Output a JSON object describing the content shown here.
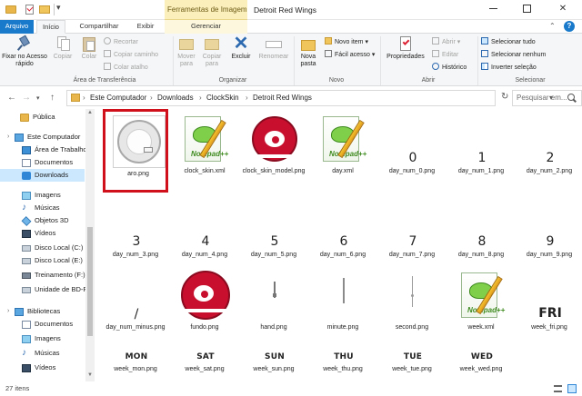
{
  "titlebar": {
    "contextual_tab_header": "Ferramentas de Imagem",
    "window_title": "Detroit Red Wings"
  },
  "tabs": {
    "file": "Arquivo",
    "home": "Início",
    "share": "Compartilhar",
    "view": "Exibir",
    "manage": "Gerenciar"
  },
  "ribbon": {
    "clipboard": {
      "pin": "Fixar no Acesso rápido",
      "copy": "Copiar",
      "paste": "Colar",
      "cut": "Recortar",
      "copy_path": "Copiar caminho",
      "paste_shortcut": "Colar atalho",
      "label": "Área de Transferência"
    },
    "organize": {
      "move_to": "Mover para",
      "copy_to": "Copiar para",
      "delete": "Excluir",
      "rename": "Renomear",
      "label": "Organizar"
    },
    "new": {
      "new_folder": "Nova pasta",
      "new_item": "Novo item",
      "easy_access": "Fácil acesso",
      "label": "Novo"
    },
    "open": {
      "properties": "Propriedades",
      "open": "Abrir",
      "edit": "Editar",
      "history": "Histórico",
      "label": "Abrir"
    },
    "select": {
      "select_all": "Selecionar tudo",
      "select_none": "Selecionar nenhum",
      "invert": "Inverter seleção",
      "label": "Selecionar"
    }
  },
  "address": {
    "crumbs": [
      "Este Computador",
      "Downloads",
      "ClockSkin",
      "Detroit Red Wings"
    ],
    "search_placeholder": "Pesquisar em..."
  },
  "navpane": {
    "items": [
      {
        "label": "Pública",
        "icon": "folder-icon",
        "selected": false
      },
      {
        "label": "Este Computador",
        "icon": "computer-icon",
        "selected": false
      },
      {
        "label": "Área de Trabalho",
        "icon": "desktop-icon",
        "selected": false
      },
      {
        "label": "Documentos",
        "icon": "documents-icon",
        "selected": false
      },
      {
        "label": "Downloads",
        "icon": "downloads-icon",
        "selected": true
      },
      {
        "label": "Imagens",
        "icon": "pictures-icon",
        "selected": false
      },
      {
        "label": "Músicas",
        "icon": "music-icon",
        "selected": false
      },
      {
        "label": "Objetos 3D",
        "icon": "objects3d-icon",
        "selected": false
      },
      {
        "label": "Vídeos",
        "icon": "videos-icon",
        "selected": false
      },
      {
        "label": "Disco Local (C:)",
        "icon": "drive-icon",
        "selected": false
      },
      {
        "label": "Disco Local (E:)",
        "icon": "drive-icon",
        "selected": false
      },
      {
        "label": "Treinamento (F:)",
        "icon": "network-drive-icon",
        "selected": false
      },
      {
        "label": "Unidade de BD-R",
        "icon": "disc-drive-icon",
        "selected": false
      },
      {
        "label": "Bibliotecas",
        "icon": "libraries-icon",
        "selected": false
      },
      {
        "label": "Documentos",
        "icon": "documents-icon",
        "selected": false
      },
      {
        "label": "Imagens",
        "icon": "pictures-icon",
        "selected": false
      },
      {
        "label": "Músicas",
        "icon": "music-icon",
        "selected": false
      },
      {
        "label": "Vídeos",
        "icon": "videos-icon",
        "selected": false
      }
    ]
  },
  "files": [
    {
      "name": "aro.png",
      "kind": "aro",
      "selected": true
    },
    {
      "name": "clock_skin.xml",
      "kind": "xml"
    },
    {
      "name": "clock_skin_model.png",
      "kind": "rw"
    },
    {
      "name": "day.xml",
      "kind": "xml"
    },
    {
      "name": "day_num_0.png",
      "kind": "glyph",
      "glyph": "0"
    },
    {
      "name": "day_num_1.png",
      "kind": "glyph",
      "glyph": "1"
    },
    {
      "name": "day_num_2.png",
      "kind": "glyph",
      "glyph": "2"
    },
    {
      "name": "day_num_3.png",
      "kind": "glyph",
      "glyph": "3"
    },
    {
      "name": "day_num_4.png",
      "kind": "glyph",
      "glyph": "4"
    },
    {
      "name": "day_num_5.png",
      "kind": "glyph",
      "glyph": "5"
    },
    {
      "name": "day_num_6.png",
      "kind": "glyph",
      "glyph": "6"
    },
    {
      "name": "day_num_7.png",
      "kind": "glyph",
      "glyph": "7"
    },
    {
      "name": "day_num_8.png",
      "kind": "glyph",
      "glyph": "8"
    },
    {
      "name": "day_num_9.png",
      "kind": "glyph",
      "glyph": "9"
    },
    {
      "name": "day_num_minus.png",
      "kind": "glyph",
      "glyph": "/"
    },
    {
      "name": "fundo.png",
      "kind": "fundo"
    },
    {
      "name": "hand.png",
      "kind": "hand"
    },
    {
      "name": "minute.png",
      "kind": "minute"
    },
    {
      "name": "second.png",
      "kind": "second"
    },
    {
      "name": "week.xml",
      "kind": "xml"
    },
    {
      "name": "week_fri.png",
      "kind": "fri",
      "glyph": "FRI"
    },
    {
      "name": "week_mon.png",
      "kind": "word",
      "glyph": "MON"
    },
    {
      "name": "week_sat.png",
      "kind": "word",
      "glyph": "SAT"
    },
    {
      "name": "week_sun.png",
      "kind": "word",
      "glyph": "SUN"
    },
    {
      "name": "week_thu.png",
      "kind": "word",
      "glyph": "THU"
    },
    {
      "name": "week_tue.png",
      "kind": "word",
      "glyph": "TUE"
    },
    {
      "name": "week_wed.png",
      "kind": "word",
      "glyph": "WED"
    }
  ],
  "thumb_text": {
    "notepad_brand": "Notepad++"
  },
  "status": {
    "count": "27 itens"
  },
  "colors": {
    "accent": "#1979ca",
    "selection_outline": "#d0101a",
    "contextual_tab": "#fbf0bc"
  }
}
